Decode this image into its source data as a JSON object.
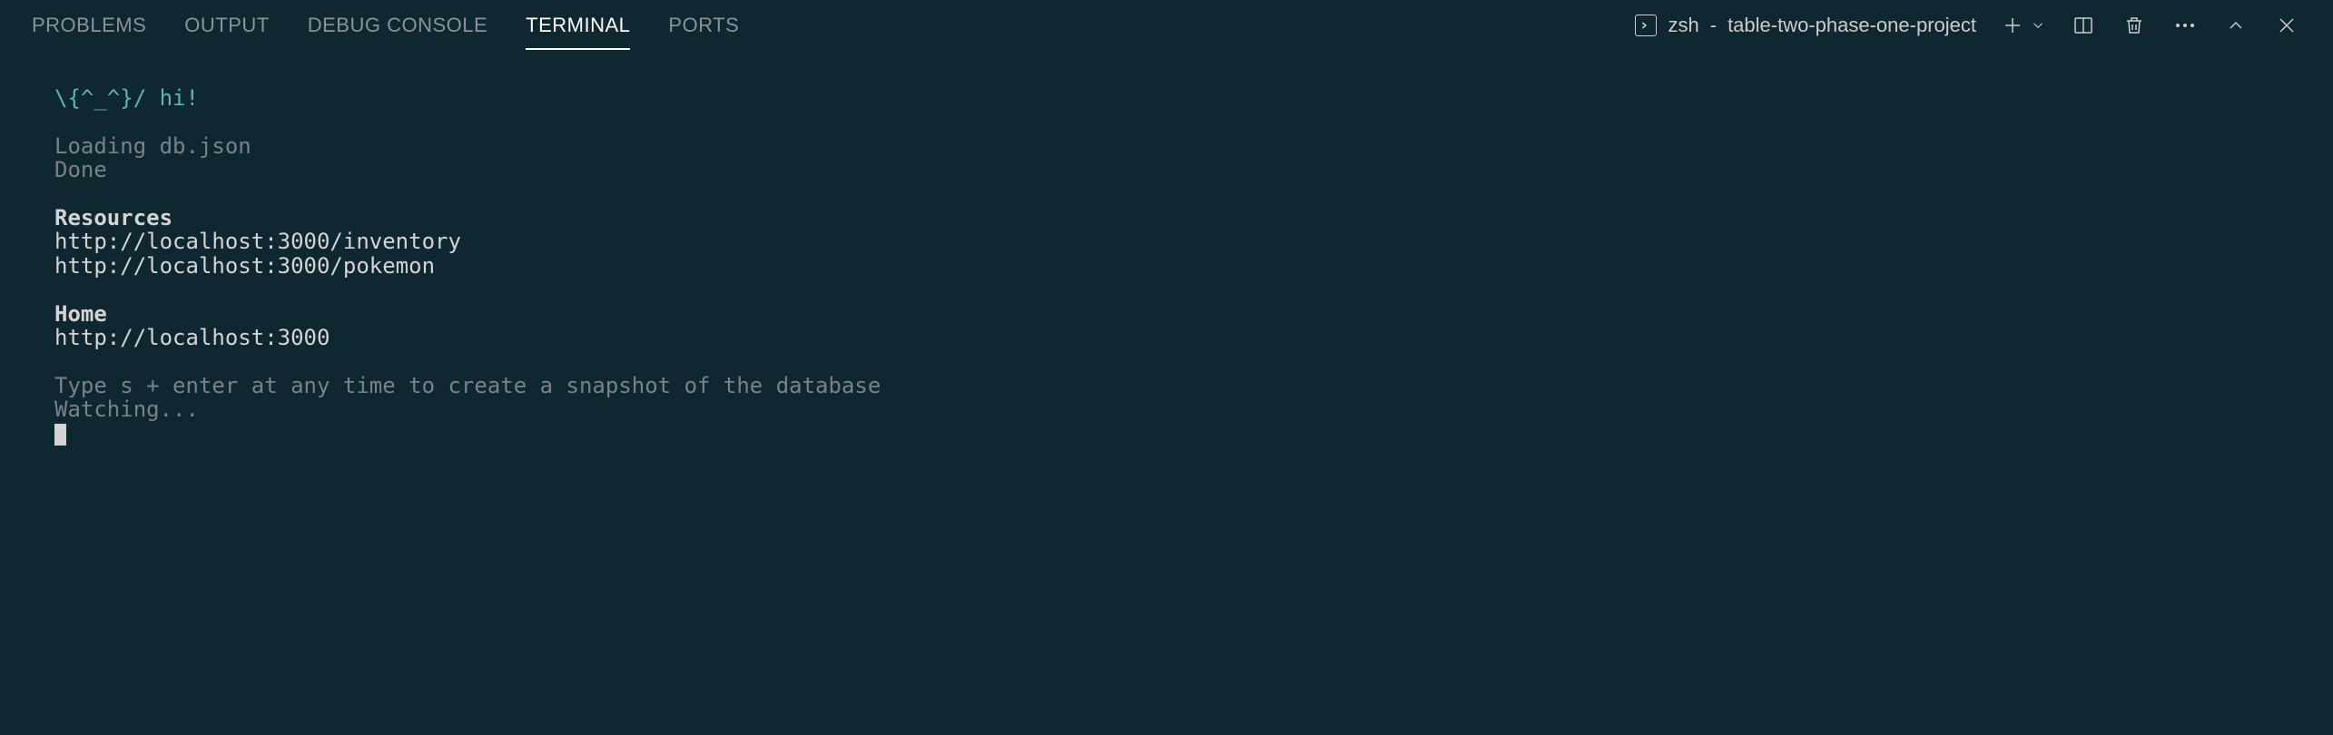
{
  "tabs": {
    "problems": "PROBLEMS",
    "output": "OUTPUT",
    "debug_console": "DEBUG CONSOLE",
    "terminal": "TERMINAL",
    "ports": "PORTS"
  },
  "terminal_info": {
    "shell": "zsh",
    "separator": "-",
    "project": "table-two-phase-one-project"
  },
  "terminal_output": {
    "greet": "\\{^_^}/ hi!",
    "loading": "Loading db.json",
    "done": "Done",
    "resources_header": "Resources",
    "resource1": "http://localhost:3000/inventory",
    "resource2": "http://localhost:3000/pokemon",
    "home_header": "Home",
    "home_url": "http://localhost:3000",
    "snapshot_hint": "Type s + enter at any time to create a snapshot of the database",
    "watching": "Watching..."
  }
}
